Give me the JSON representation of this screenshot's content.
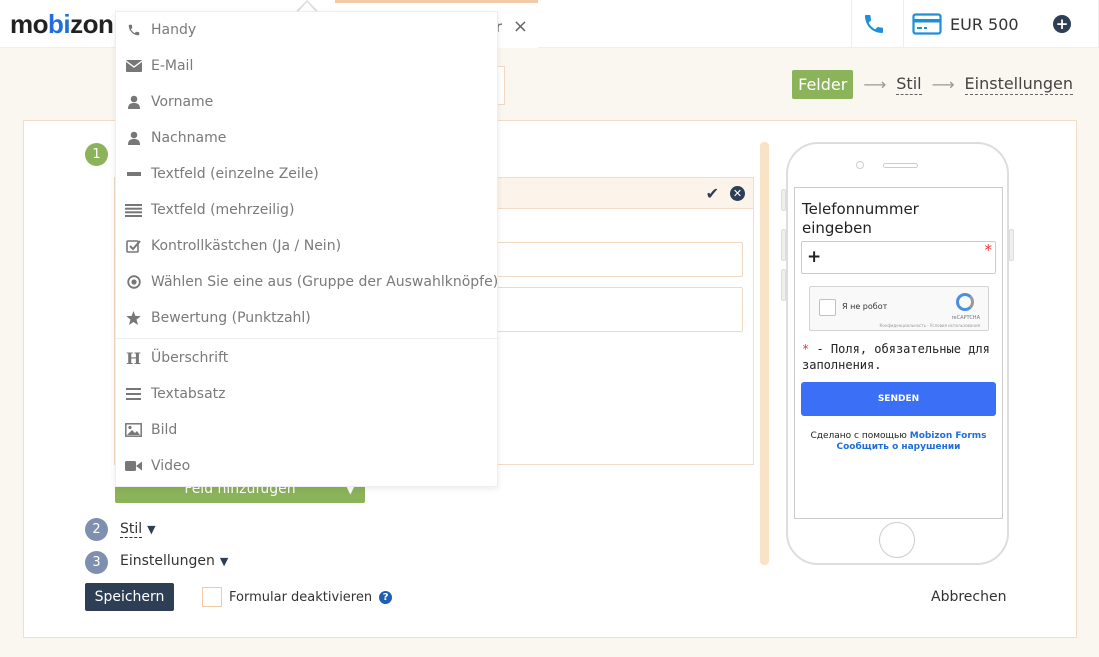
{
  "header": {
    "logo_start": "mo",
    "logo_bi": "bi",
    "logo_end": "zon",
    "tab_trailing_text": "r",
    "tab_close": "×",
    "balance": "EUR 500"
  },
  "wizard": {
    "steps": [
      "Felder",
      "Stil",
      "Einstellungen"
    ],
    "arrow": "⟶"
  },
  "sections": [
    {
      "num": "1",
      "label": ""
    },
    {
      "num": "2",
      "label": "Stil"
    },
    {
      "num": "3",
      "label": "Einstellungen"
    }
  ],
  "add_field_label": "Feld hinzufügen",
  "save_label": "Speichern",
  "deactivate_label": "Formular deaktivieren",
  "cancel_label": "Abbrechen",
  "dropdown": {
    "items": [
      {
        "label": "Handy",
        "icon": "phone-icon"
      },
      {
        "label": "E-Mail",
        "icon": "envelope-icon"
      },
      {
        "label": "Vorname",
        "icon": "user-icon"
      },
      {
        "label": "Nachname",
        "icon": "user-icon"
      },
      {
        "label": "Textfeld (einzelne Zeile)",
        "icon": "minus-icon"
      },
      {
        "label": "Textfeld (mehrzeilig)",
        "icon": "lines-icon"
      },
      {
        "label": "Kontrollkästchen (Ja / Nein)",
        "icon": "checkbox-icon"
      },
      {
        "label": "Wählen Sie eine aus (Gruppe der Auswahlknöpfe)",
        "icon": "radio-icon"
      },
      {
        "label": "Bewertung (Punktzahl)",
        "icon": "star-icon"
      },
      {
        "label": "Überschrift",
        "icon": "heading-icon"
      },
      {
        "label": "Textabsatz",
        "icon": "paragraph-icon"
      },
      {
        "label": "Bild",
        "icon": "image-icon"
      },
      {
        "label": "Video",
        "icon": "video-icon"
      }
    ]
  },
  "preview": {
    "title": "Telefonnummer eingeben",
    "input_prefix": "+",
    "required_mark": "*",
    "captcha_text": "Я не робот",
    "captcha_brand": "reCAPTCHA",
    "captcha_fine": "Конфиденциальность - Условия использования",
    "required_note": "- Поля, обязательные для заполнения.",
    "send_label": "SENDEN",
    "made_with": "Сделано с помощью",
    "made_link": "Mobizon Forms",
    "report_link": "Сообщить о нарушении"
  },
  "colors": {
    "accent_green": "#8bb35a",
    "navy": "#2d3e55",
    "send_blue": "#3b6ff5",
    "brand_blue": "#1e6fd9"
  }
}
